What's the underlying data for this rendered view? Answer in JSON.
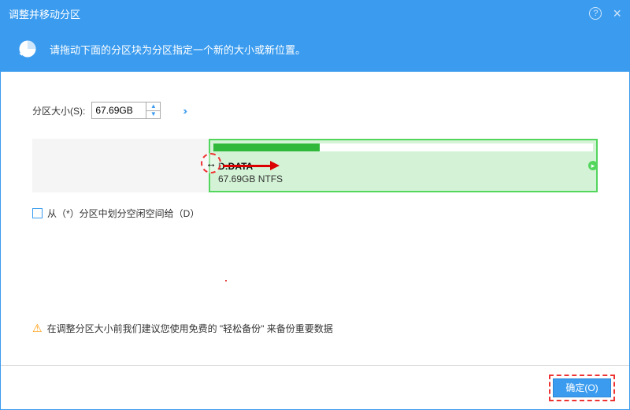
{
  "titlebar": {
    "title": "调整并移动分区"
  },
  "banner": {
    "text": "请拖动下面的分区块为分区指定一个新的大小或新位置。"
  },
  "size": {
    "label": "分区大小(S):",
    "value": "67.69GB"
  },
  "partition": {
    "name": "D:DATA",
    "detail": "67.69GB NTFS"
  },
  "checkbox": {
    "label": "从（*）分区中划分空闲空间给（D）"
  },
  "warning": {
    "text": "在调整分区大小前我们建议您使用免费的 \"轻松备份\" 来备份重要数据"
  },
  "footer": {
    "ok": "确定(O)"
  }
}
